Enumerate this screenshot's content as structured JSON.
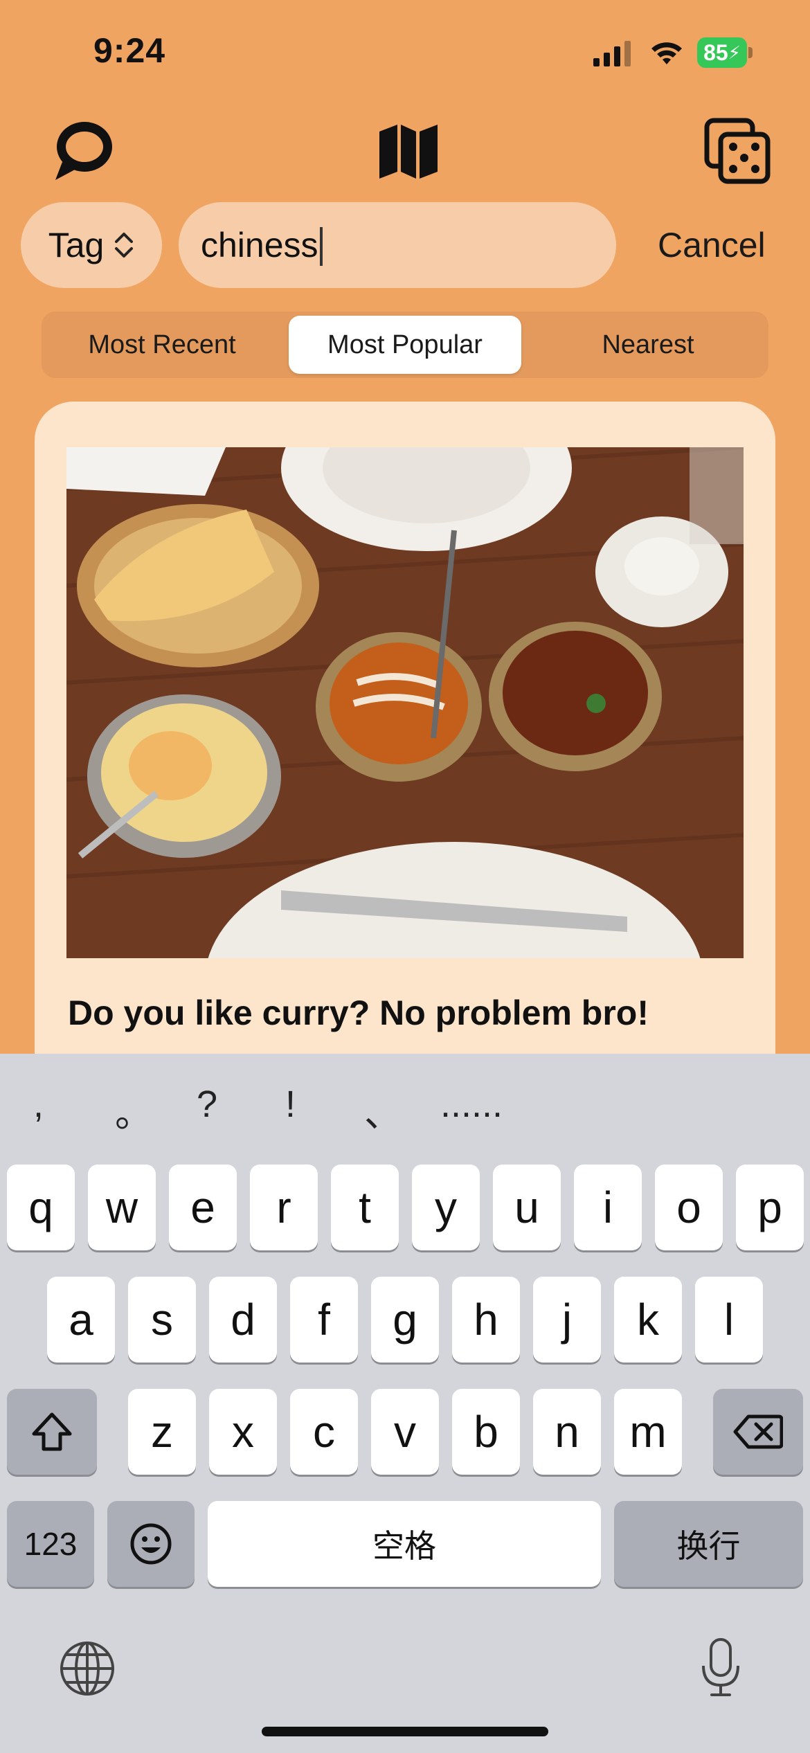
{
  "status": {
    "time": "9:24",
    "battery": "85"
  },
  "top_icons": [
    "chat-bubble-icon",
    "map-icon",
    "dice-icon"
  ],
  "search": {
    "tag_label": "Tag",
    "query": "chiness",
    "cancel_label": "Cancel"
  },
  "tabs": [
    {
      "label": "Most Recent",
      "active": false
    },
    {
      "label": "Most Popular",
      "active": true
    },
    {
      "label": "Nearest",
      "active": false
    }
  ],
  "post": {
    "title": "Do you like curry? No problem bro!"
  },
  "keyboard": {
    "candidates": [
      ",",
      "。",
      "?",
      "!",
      "、",
      "......"
    ],
    "row1": [
      "q",
      "w",
      "e",
      "r",
      "t",
      "y",
      "u",
      "i",
      "o",
      "p"
    ],
    "row2": [
      "a",
      "s",
      "d",
      "f",
      "g",
      "h",
      "j",
      "k",
      "l"
    ],
    "row3": [
      "z",
      "x",
      "c",
      "v",
      "b",
      "n",
      "m"
    ],
    "numbers_label": "123",
    "space_label": "空格",
    "return_label": "换行"
  },
  "colors": {
    "background": "#F0A462",
    "card": "#FDE5CC",
    "field": "#F6CDA8",
    "keyboard": "#D3D5DB"
  }
}
